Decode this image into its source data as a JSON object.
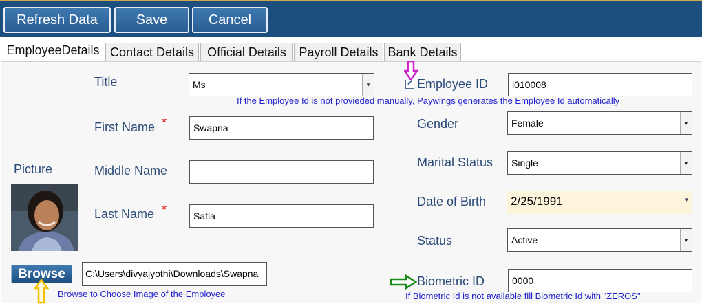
{
  "toolbar": {
    "refresh_label": "Refresh Data",
    "save_label": "Save",
    "cancel_label": "Cancel"
  },
  "tabs": [
    {
      "label": "EmployeeDetails"
    },
    {
      "label": "Contact Details"
    },
    {
      "label": "Official Details"
    },
    {
      "label": "Payroll Details"
    },
    {
      "label": "Bank Details"
    }
  ],
  "form": {
    "title_label": "Title",
    "title_value": "Ms",
    "first_name_label": "First Name",
    "first_name_value": "Swapna",
    "middle_name_label": "Middle Name",
    "middle_name_value": "",
    "last_name_label": "Last Name",
    "last_name_value": "Satla",
    "required_mark": "*",
    "picture_label": "Picture",
    "browse_label": "Browse",
    "file_path": "C:\\Users\\divyajyothi\\Downloads\\Swapna",
    "browse_note": "Browse to Choose Image of the Employee",
    "employee_id_label": "Employee ID",
    "employee_id_value": "i010008",
    "employee_id_note": "If the Employee Id is not provieded manually, Paywings generates the Employee Id automatically",
    "gender_label": "Gender",
    "gender_value": "Female",
    "marital_label": "Marital Status",
    "marital_value": "Single",
    "dob_label": "Date of Birth",
    "dob_value": "2/25/1991",
    "status_label": "Status",
    "status_value": "Active",
    "biometric_label": "Biometric ID",
    "biometric_value": "0000",
    "biometric_note": "If Biometric Id is not available fill Biometric Id with \"ZEROS\""
  },
  "colors": {
    "toolbar_bg": "#1c4f7e",
    "label": "#2b4a78",
    "required": "#e01010",
    "note": "#2222cc",
    "dob_bg": "#fdf4dc",
    "magenta_arrow": "#cc22cc",
    "yellow_arrow": "#f5c000",
    "green_arrow": "#1a8a1a"
  }
}
